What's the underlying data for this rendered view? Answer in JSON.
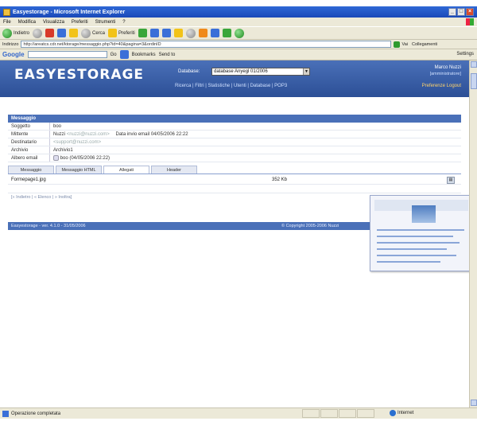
{
  "window": {
    "title": "Easyestorage - Microsoft Internet Explorer"
  },
  "menu": [
    "File",
    "Modifica",
    "Visualizza",
    "Preferiti",
    "Strumenti",
    "?"
  ],
  "toolbar": {
    "back": "Indietro",
    "search": "Cerca",
    "favorites": "Preferiti"
  },
  "address": {
    "label": "Indirizzo",
    "url": "http://areatcs.cdr.net/ktorage/messaggio.php?id=40&pagina=3&ordinID",
    "go": "Vai",
    "links": "Collegamenti"
  },
  "googlebar": {
    "logo": "Google",
    "go": "Go",
    "bookmarks": "Bookmarks",
    "sendto": "Send to",
    "settings": "Settings"
  },
  "app": {
    "logo": "EASYESTORAGE",
    "database_label": "Database:",
    "database_value": "database Anyegl 01/2006",
    "nav": "Ricerca | Filtri | Statistiche | Utenti | Database | POP3",
    "user_name": "Marco Nuzzi",
    "user_role": "[amministratore]",
    "user_links": "Preferenze  Logout"
  },
  "message": {
    "header": "Messaggio",
    "fields": [
      {
        "label": "Soggetto",
        "value": "boo"
      },
      {
        "label": "Mittente",
        "value": "Nuzzi",
        "muted": "<nuzzi@nuzzi.com>",
        "date_label": "Data invio email",
        "date": "04/05/2006 22:22"
      },
      {
        "label": "Destinatario",
        "value": "",
        "muted": "<support@nuzzi.com>"
      },
      {
        "label": "Archivio",
        "value": "Archivio1"
      },
      {
        "label": "Albero email",
        "value": "boo (04/05/2006 22:22)"
      }
    ],
    "tabs": [
      "Messaggio",
      "Messaggio HTML",
      "Allegati",
      "Header"
    ],
    "active_tab": 2,
    "attachment": {
      "name": "Formepage1.jpg",
      "size": "352 Kb"
    },
    "pager": "[« Indietro | « Elenco | » Inoltra]"
  },
  "footer": {
    "version": "Easyestorage - ver. 4.1.0 - 31/05/2006",
    "copyright": "© Copyright 2005-2006 Nuzzi"
  },
  "status": {
    "text": "Operazione completata",
    "zone": "Internet"
  }
}
